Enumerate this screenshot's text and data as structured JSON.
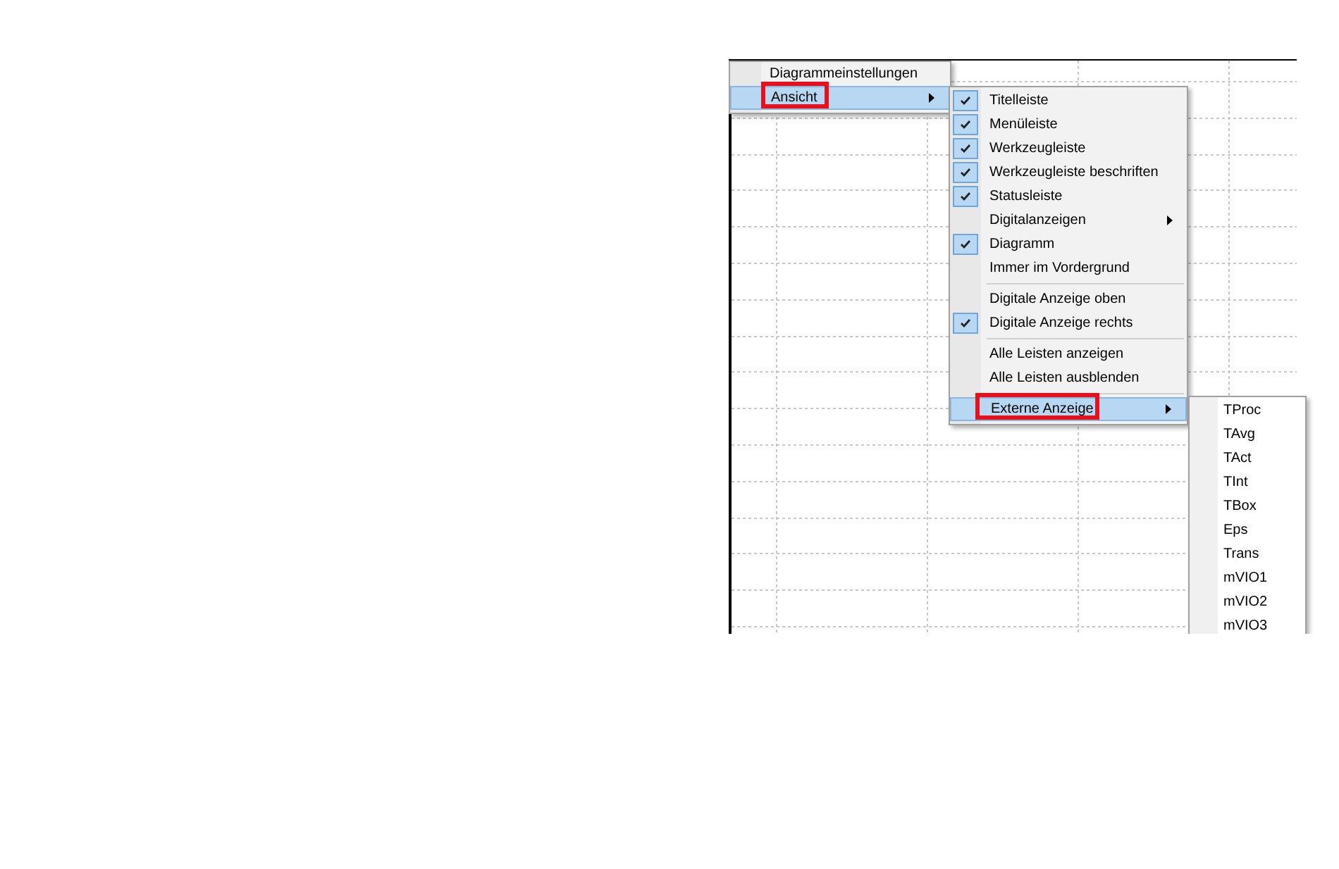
{
  "context_menu": {
    "items": [
      {
        "label": "Diagrammeinstellungen",
        "kind": "item",
        "selected": false,
        "highlighted": false
      },
      {
        "label": "Ansicht",
        "kind": "submenu",
        "selected": true,
        "highlighted": true
      }
    ]
  },
  "view_menu": {
    "items": [
      {
        "label": "Titelleiste",
        "kind": "check",
        "checked": true,
        "selected": false,
        "highlighted": false
      },
      {
        "label": "Menüleiste",
        "kind": "check",
        "checked": true,
        "selected": false,
        "highlighted": false
      },
      {
        "label": "Werkzeugleiste",
        "kind": "check",
        "checked": true,
        "selected": false,
        "highlighted": false
      },
      {
        "label": "Werkzeugleiste beschriften",
        "kind": "check",
        "checked": true,
        "selected": false,
        "highlighted": false
      },
      {
        "label": "Statusleiste",
        "kind": "check",
        "checked": true,
        "selected": false,
        "highlighted": false
      },
      {
        "label": "Digitalanzeigen",
        "kind": "submenu",
        "selected": false,
        "highlighted": false
      },
      {
        "label": "Diagramm",
        "kind": "check",
        "checked": true,
        "selected": false,
        "highlighted": false
      },
      {
        "label": "Immer im Vordergrund",
        "kind": "check",
        "checked": false,
        "selected": false,
        "highlighted": false
      },
      {
        "kind": "separator"
      },
      {
        "label": "Digitale Anzeige oben",
        "kind": "check",
        "checked": false,
        "selected": false,
        "highlighted": false
      },
      {
        "label": "Digitale Anzeige rechts",
        "kind": "check",
        "checked": true,
        "selected": false,
        "highlighted": false
      },
      {
        "kind": "separator"
      },
      {
        "label": "Alle Leisten anzeigen",
        "kind": "item",
        "selected": false,
        "highlighted": false
      },
      {
        "label": "Alle Leisten ausblenden",
        "kind": "item",
        "selected": false,
        "highlighted": false
      },
      {
        "kind": "separator"
      },
      {
        "label": "Externe Anzeige",
        "kind": "submenu",
        "selected": true,
        "highlighted": true
      }
    ]
  },
  "external_menu": {
    "items": [
      {
        "label": "TProc"
      },
      {
        "label": "TAvg"
      },
      {
        "label": "TAct"
      },
      {
        "label": "TInt"
      },
      {
        "label": "TBox"
      },
      {
        "label": "Eps"
      },
      {
        "label": "Trans"
      },
      {
        "label": "mVIO1"
      },
      {
        "label": "mVIO2"
      },
      {
        "label": "mVIO3"
      }
    ]
  }
}
